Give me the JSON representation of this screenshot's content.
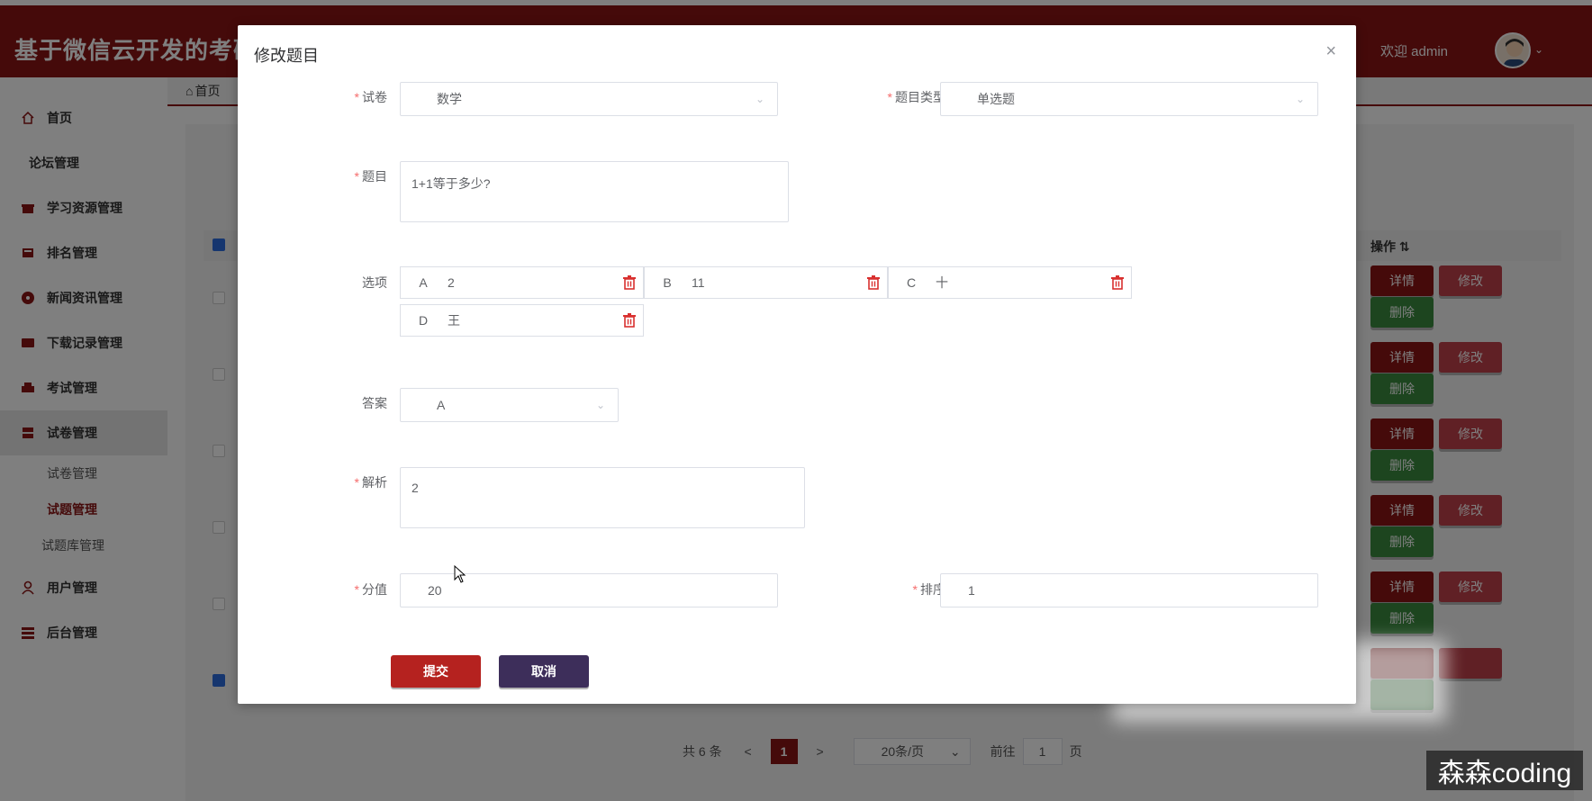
{
  "app": {
    "title": "基于微信云开发的考研",
    "welcome": "欢迎 admin",
    "watermark": "森森coding"
  },
  "sidebar": {
    "items": [
      {
        "label": "首页",
        "icon": "home-icon"
      },
      {
        "label": "论坛管理",
        "icon": ""
      },
      {
        "label": "学习资源管理",
        "icon": "gift-icon"
      },
      {
        "label": "排名管理",
        "icon": "book-icon"
      },
      {
        "label": "新闻资讯管理",
        "icon": "record-icon"
      },
      {
        "label": "下载记录管理",
        "icon": "card-icon"
      },
      {
        "label": "考试管理",
        "icon": "printer-icon"
      },
      {
        "label": "试卷管理",
        "icon": "archive-icon"
      },
      {
        "label": "用户管理",
        "icon": "user-icon"
      },
      {
        "label": "后台管理",
        "icon": "server-icon"
      }
    ],
    "sub": [
      "试卷管理",
      "试题管理",
      "试题库管理"
    ]
  },
  "breadcrumb": {
    "home": "首页"
  },
  "table": {
    "ops_header": "操作",
    "btn_detail": "详情",
    "btn_edit": "修改",
    "btn_delete": "删除"
  },
  "pagination": {
    "total": "共 6 条",
    "prev": "<",
    "current": "1",
    "next": ">",
    "size": "20条/页",
    "goto": "前往",
    "page_input": "1",
    "page_suffix": "页"
  },
  "dialog": {
    "title": "修改题目",
    "close": "×",
    "paper": {
      "label": "试卷",
      "value": "数学"
    },
    "type": {
      "label": "题目类型",
      "value": "单选题"
    },
    "question": {
      "label": "题目",
      "value": "1+1等于多少?"
    },
    "options": {
      "label": "选项",
      "items": [
        {
          "key": "A",
          "value": "2"
        },
        {
          "key": "B",
          "value": "11"
        },
        {
          "key": "C",
          "value": "十"
        },
        {
          "key": "D",
          "value": "王"
        }
      ]
    },
    "answer": {
      "label": "答案",
      "value": "A"
    },
    "analysis": {
      "label": "解析",
      "value": "2"
    },
    "score": {
      "label": "分值",
      "value": "20"
    },
    "order": {
      "label": "排序",
      "value": "1"
    },
    "submit": "提交",
    "cancel": "取消"
  }
}
